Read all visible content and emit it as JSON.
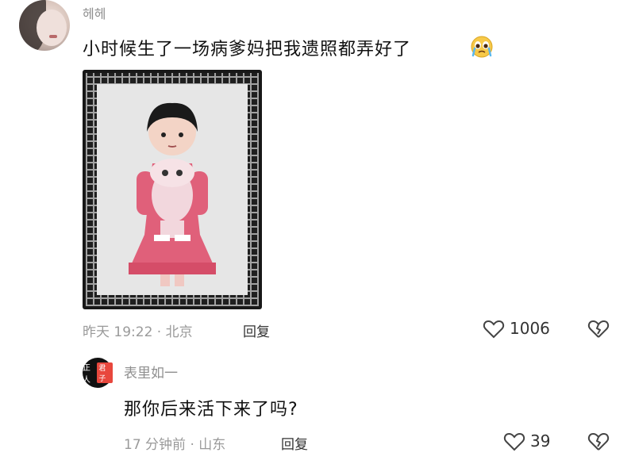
{
  "comment1": {
    "username": "헤헤",
    "text": "小时候生了一场病爹妈把我遗照都弄好了",
    "emoji": "crying-face-icon",
    "time_location": "昨天 19:22 · 北京",
    "reply_label": "回复",
    "like_count": "1006"
  },
  "comment2": {
    "badge_text": "正人",
    "badge_tag": "君子",
    "username": "表里如一",
    "text": "那你后来活下来了吗?",
    "time_location": "17 分钟前 · 山东",
    "reply_label": "回复",
    "like_count": "39"
  },
  "colors": {
    "meta": "#9a9a9a",
    "dress": "#e0607a",
    "frame": "#181818"
  }
}
